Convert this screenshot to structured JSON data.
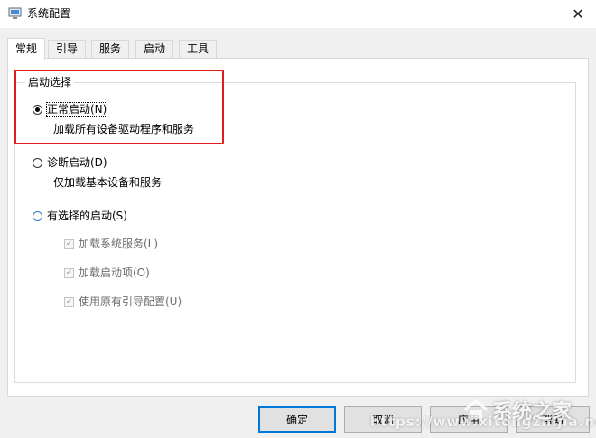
{
  "window": {
    "title": "系统配置"
  },
  "tabs": [
    {
      "label": "常规",
      "active": true
    },
    {
      "label": "引导"
    },
    {
      "label": "服务"
    },
    {
      "label": "启动"
    },
    {
      "label": "工具"
    }
  ],
  "startup_group": {
    "legend": "启动选择",
    "options": [
      {
        "label": "正常启动(N)",
        "description": "加载所有设备驱动程序和服务",
        "selected": true
      },
      {
        "label": "诊断启动(D)",
        "description": "仅加载基本设备和服务",
        "selected": false
      },
      {
        "label": "有选择的启动(S)",
        "selected": false
      }
    ],
    "sub_options": [
      {
        "label": "加载系统服务(L)",
        "checked": true,
        "enabled": false
      },
      {
        "label": "加载启动项(O)",
        "checked": true,
        "enabled": false
      },
      {
        "label": "使用原有引导配置(U)",
        "checked": true,
        "enabled": false
      }
    ]
  },
  "buttons": {
    "ok": "确定",
    "cancel": "取消",
    "apply": "应用",
    "help": "帮助"
  },
  "watermark": {
    "url": "https://www.xitongzhijia.net",
    "brand": "系统之家"
  },
  "colors": {
    "highlight": "#e11e1e",
    "default_button_border": "#0078d7"
  }
}
